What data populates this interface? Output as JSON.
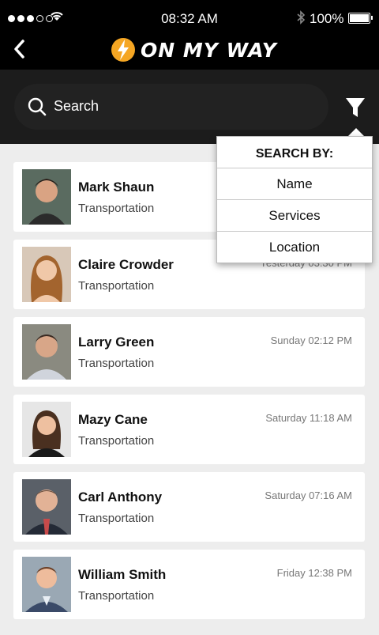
{
  "status_bar": {
    "time": "08:32 AM",
    "battery": "100%"
  },
  "header": {
    "logo_text": "ON MY WAY",
    "back_icon": "chevron-left-icon",
    "logo_icon": "lightning-bolt-icon"
  },
  "search": {
    "placeholder": "Search",
    "icon": "search-icon",
    "filter_icon": "filter-icon"
  },
  "dropdown": {
    "title": "SEARCH BY:",
    "options": [
      "Name",
      "Services",
      "Location"
    ]
  },
  "contacts": [
    {
      "name": "Mark Shaun",
      "category": "Transportation",
      "time": ""
    },
    {
      "name": "Claire Crowder",
      "category": "Transportation",
      "time": "Yesterday 03:30 PM"
    },
    {
      "name": "Larry Green",
      "category": "Transportation",
      "time": "Sunday  02:12 PM"
    },
    {
      "name": "Mazy Cane",
      "category": "Transportation",
      "time": "Saturday  11:18 AM"
    },
    {
      "name": "Carl Anthony",
      "category": "Transportation",
      "time": "Saturday  07:16 AM"
    },
    {
      "name": "William Smith",
      "category": "Transportation",
      "time": "Friday  12:38 PM"
    }
  ],
  "colors": {
    "header_bg": "#000000",
    "search_bg": "#1c1c1c",
    "list_bg": "#ededed",
    "logo_accent": "#f5a623"
  }
}
